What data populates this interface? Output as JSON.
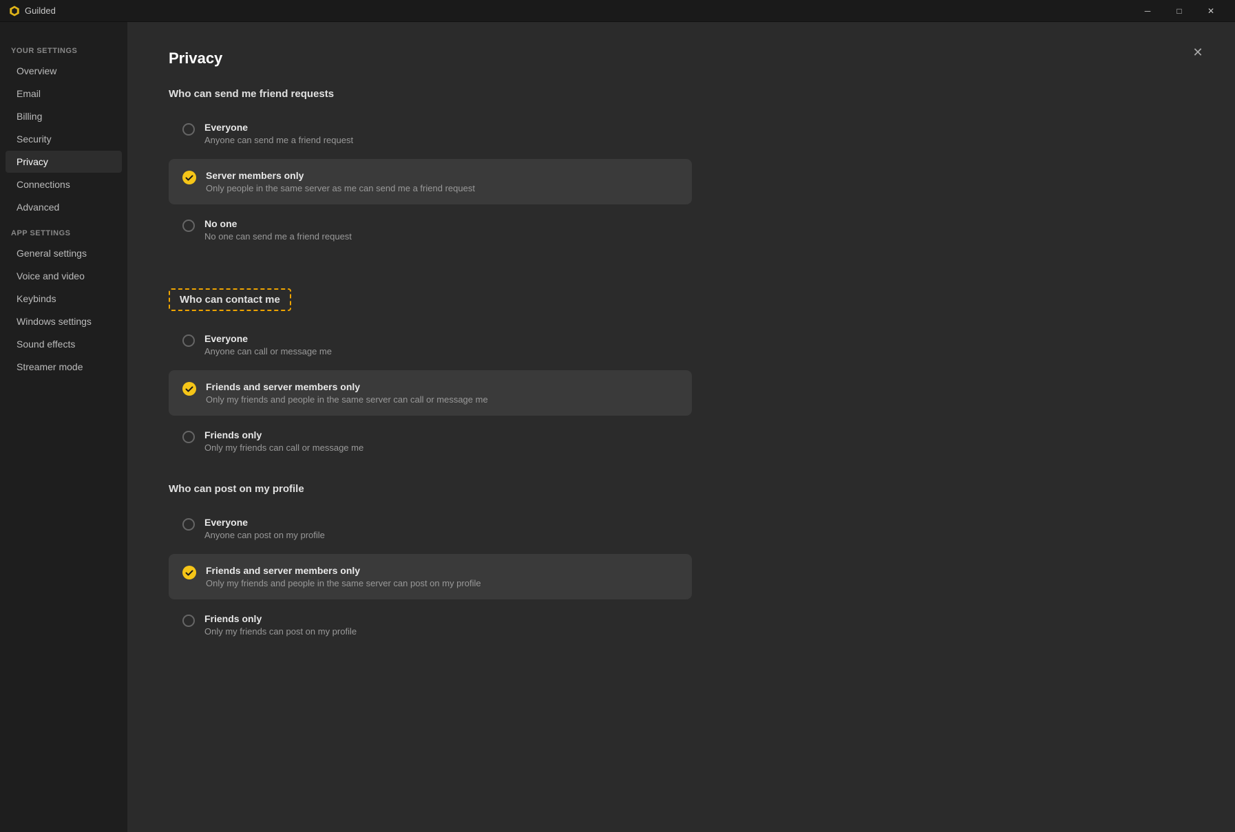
{
  "app": {
    "name": "Guilded",
    "title_controls": {
      "minimize": "─",
      "maximize": "□",
      "close": "✕"
    }
  },
  "sidebar": {
    "your_settings_label": "Your settings",
    "app_settings_label": "App settings",
    "items_your": [
      {
        "id": "overview",
        "label": "Overview",
        "active": false
      },
      {
        "id": "email",
        "label": "Email",
        "active": false
      },
      {
        "id": "billing",
        "label": "Billing",
        "active": false
      },
      {
        "id": "security",
        "label": "Security",
        "active": false
      },
      {
        "id": "privacy",
        "label": "Privacy",
        "active": true
      },
      {
        "id": "connections",
        "label": "Connections",
        "active": false
      },
      {
        "id": "advanced",
        "label": "Advanced",
        "active": false
      }
    ],
    "items_app": [
      {
        "id": "general-settings",
        "label": "General settings",
        "active": false
      },
      {
        "id": "voice-and-video",
        "label": "Voice and video",
        "active": false
      },
      {
        "id": "keybinds",
        "label": "Keybinds",
        "active": false
      },
      {
        "id": "windows-settings",
        "label": "Windows settings",
        "active": false
      },
      {
        "id": "sound-effects",
        "label": "Sound effects",
        "active": false
      },
      {
        "id": "streamer-mode",
        "label": "Streamer mode",
        "active": false
      }
    ]
  },
  "content": {
    "page_title": "Privacy",
    "sections": [
      {
        "id": "friend-requests",
        "header": "Who can send me friend requests",
        "highlighted": false,
        "options": [
          {
            "id": "fr-everyone",
            "title": "Everyone",
            "description": "Anyone can send me a friend request",
            "selected": false
          },
          {
            "id": "fr-server-members",
            "title": "Server members only",
            "description": "Only people in the same server as me can send me a friend request",
            "selected": true
          },
          {
            "id": "fr-no-one",
            "title": "No one",
            "description": "No one can send me a friend request",
            "selected": false
          }
        ]
      },
      {
        "id": "contact-me",
        "header": "Who can contact me",
        "highlighted": true,
        "options": [
          {
            "id": "cm-everyone",
            "title": "Everyone",
            "description": "Anyone can call or message me",
            "selected": false
          },
          {
            "id": "cm-friends-server",
            "title": "Friends and server members only",
            "description": "Only my friends and people in the same server can call or message me",
            "selected": true
          },
          {
            "id": "cm-friends-only",
            "title": "Friends only",
            "description": "Only my friends can call or message me",
            "selected": false
          }
        ]
      },
      {
        "id": "post-profile",
        "header": "Who can post on my profile",
        "highlighted": false,
        "options": [
          {
            "id": "pp-everyone",
            "title": "Everyone",
            "description": "Anyone can post on my profile",
            "selected": false
          },
          {
            "id": "pp-friends-server",
            "title": "Friends and server members only",
            "description": "Only my friends and people in the same server can post on my profile",
            "selected": true
          },
          {
            "id": "pp-friends-only",
            "title": "Friends only",
            "description": "Only my friends can post on my profile",
            "selected": false
          }
        ]
      }
    ]
  }
}
